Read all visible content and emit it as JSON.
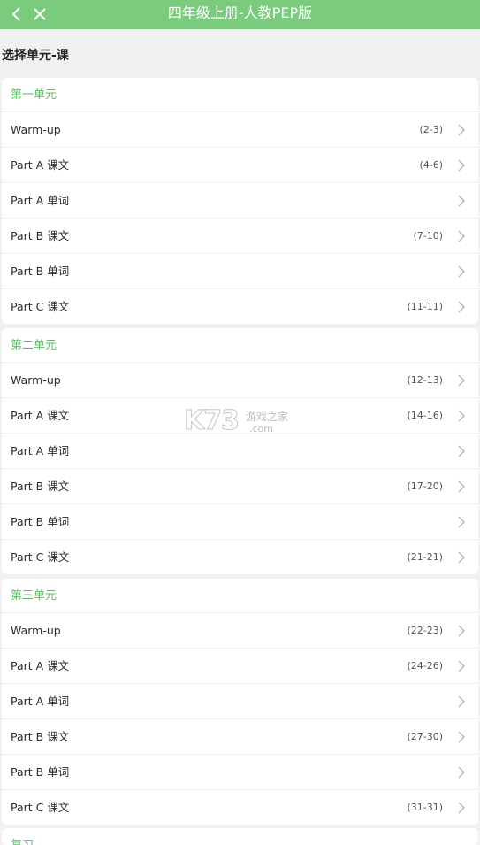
{
  "header": {
    "title": "四年级上册-人教PEP版",
    "back_icon": "chevron-left-icon",
    "close_icon": "close-icon"
  },
  "page": {
    "section_title": "选择单元-课"
  },
  "units": [
    {
      "title": "第一单元",
      "lessons": [
        {
          "label": "Warm-up",
          "range": "(2-3)"
        },
        {
          "label": "Part A 课文",
          "range": "(4-6)"
        },
        {
          "label": "Part A 单词",
          "range": ""
        },
        {
          "label": "Part B 课文",
          "range": "(7-10)"
        },
        {
          "label": "Part B 单词",
          "range": ""
        },
        {
          "label": "Part C 课文",
          "range": "(11-11)"
        }
      ]
    },
    {
      "title": "第二单元",
      "lessons": [
        {
          "label": "Warm-up",
          "range": "(12-13)"
        },
        {
          "label": "Part A 课文",
          "range": "(14-16)"
        },
        {
          "label": "Part A 单词",
          "range": ""
        },
        {
          "label": "Part B 课文",
          "range": "(17-20)"
        },
        {
          "label": "Part B 单词",
          "range": ""
        },
        {
          "label": "Part C 课文",
          "range": "(21-21)"
        }
      ]
    },
    {
      "title": "第三单元",
      "lessons": [
        {
          "label": "Warm-up",
          "range": "(22-23)"
        },
        {
          "label": "Part A 课文",
          "range": "(24-26)"
        },
        {
          "label": "Part A 单词",
          "range": ""
        },
        {
          "label": "Part B 课文",
          "range": "(27-30)"
        },
        {
          "label": "Part B 单词",
          "range": ""
        },
        {
          "label": "Part C 课文",
          "range": "(31-31)"
        }
      ]
    },
    {
      "title": "复习",
      "lessons": []
    }
  ],
  "watermark": {
    "brand": "K73",
    "name": "游戏之家",
    "domain": ".com"
  },
  "colors": {
    "header_bg": "#7acb7e",
    "unit_title": "#5cbc66",
    "page_bg": "#f1f1f1"
  }
}
